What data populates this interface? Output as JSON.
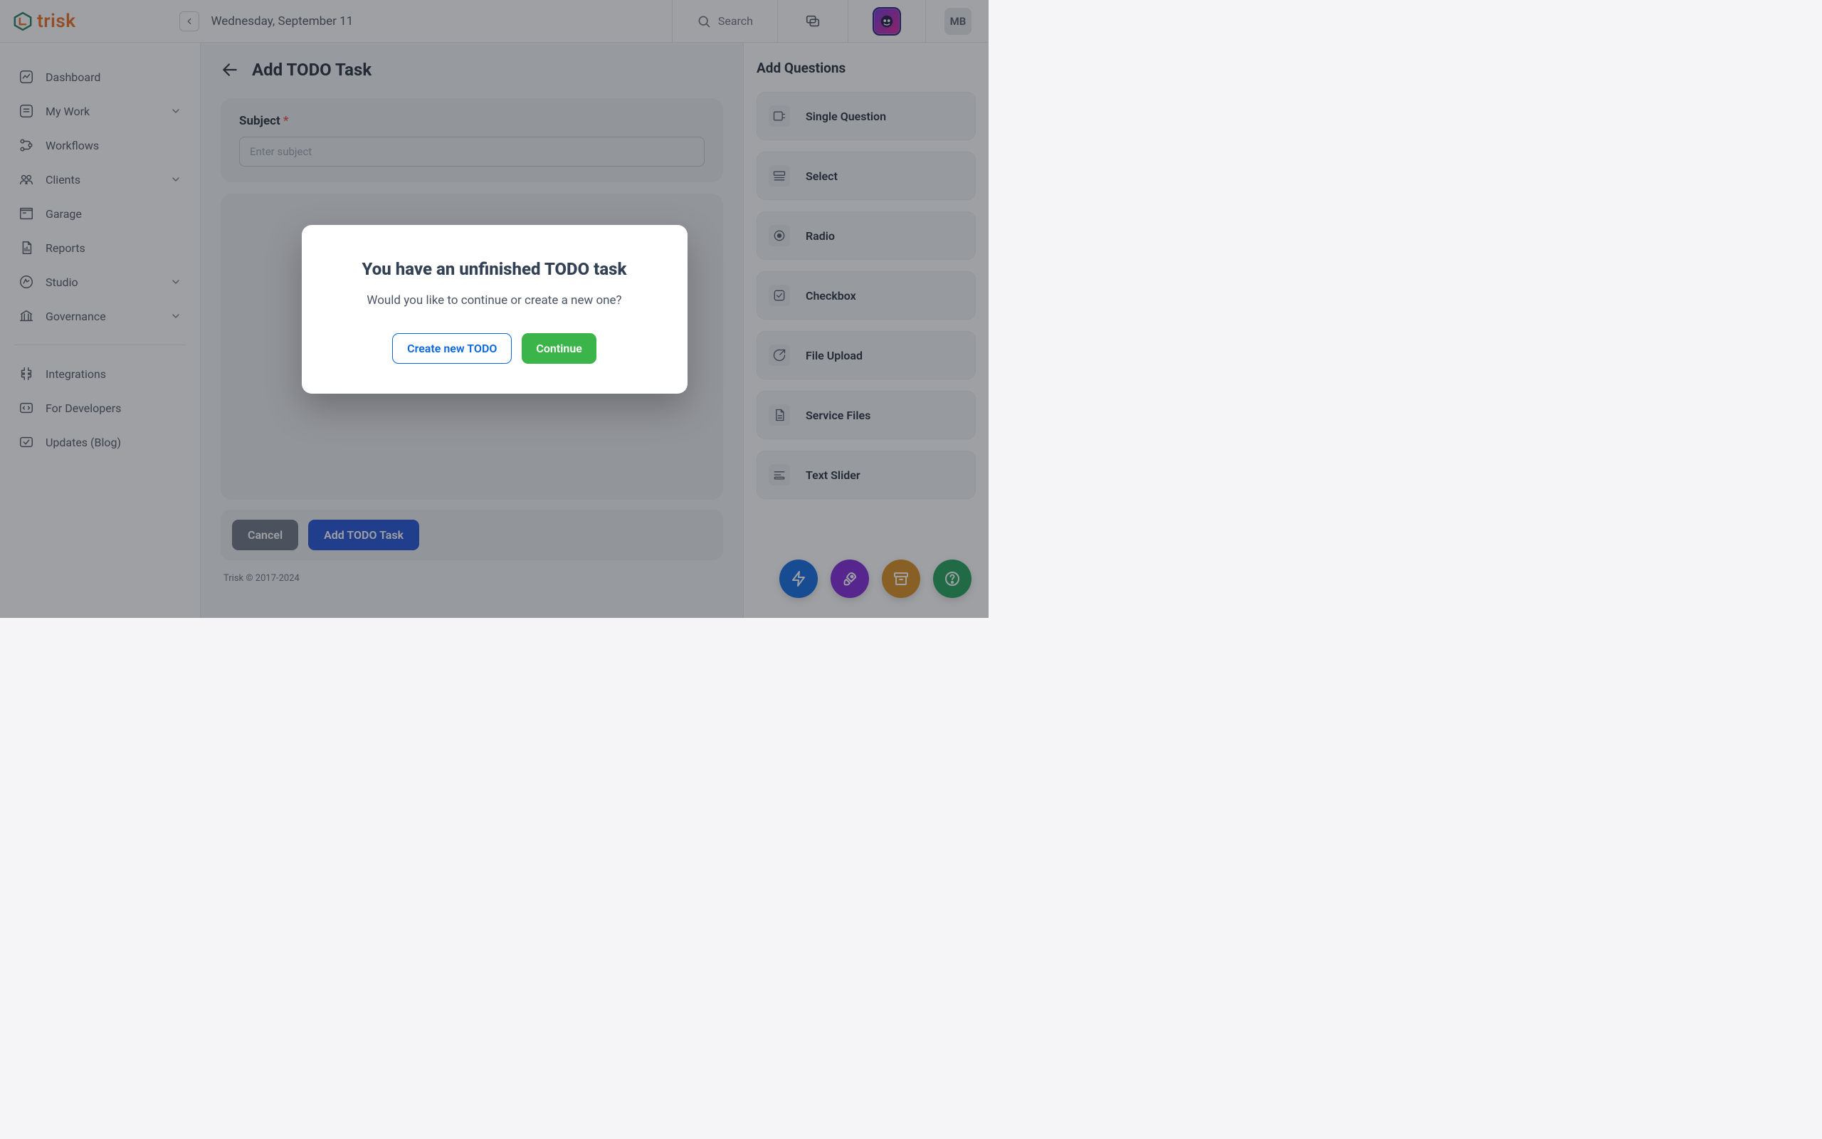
{
  "brand": {
    "name": "trisk"
  },
  "header": {
    "date": "Wednesday, September 11",
    "search_label": "Search",
    "user_initials": "MB"
  },
  "sidebar": {
    "groups": [
      [
        {
          "label": "Dashboard",
          "icon": "dashboard",
          "expandable": false
        },
        {
          "label": "My Work",
          "icon": "mywork",
          "expandable": true
        },
        {
          "label": "Workflows",
          "icon": "workflows",
          "expandable": false
        },
        {
          "label": "Clients",
          "icon": "clients",
          "expandable": true
        },
        {
          "label": "Garage",
          "icon": "garage",
          "expandable": false
        },
        {
          "label": "Reports",
          "icon": "reports",
          "expandable": false
        },
        {
          "label": "Studio",
          "icon": "studio",
          "expandable": true
        },
        {
          "label": "Governance",
          "icon": "governance",
          "expandable": true
        }
      ],
      [
        {
          "label": "Integrations",
          "icon": "integrations",
          "expandable": false
        },
        {
          "label": "For Developers",
          "icon": "developers",
          "expandable": false
        },
        {
          "label": "Updates (Blog)",
          "icon": "updates",
          "expandable": false
        }
      ]
    ]
  },
  "page": {
    "title": "Add TODO Task",
    "subject_label": "Subject",
    "subject_placeholder": "Enter subject",
    "cancel_label": "Cancel",
    "submit_label": "Add TODO Task",
    "copyright": "Trisk © 2017-2024"
  },
  "right_panel": {
    "title": "Add Questions",
    "items": [
      {
        "label": "Single Question",
        "icon": "single"
      },
      {
        "label": "Select",
        "icon": "select"
      },
      {
        "label": "Radio",
        "icon": "radio"
      },
      {
        "label": "Checkbox",
        "icon": "checkbox"
      },
      {
        "label": "File Upload",
        "icon": "file-upload"
      },
      {
        "label": "Service Files",
        "icon": "service-files"
      },
      {
        "label": "Text Slider",
        "icon": "text-slider"
      }
    ]
  },
  "modal": {
    "title": "You have an unfinished TODO task",
    "message": "Would you like to continue or create a new one?",
    "create_label": "Create new TODO",
    "continue_label": "Continue"
  },
  "fab_icons": [
    "bolt",
    "rocket",
    "archive",
    "help"
  ]
}
